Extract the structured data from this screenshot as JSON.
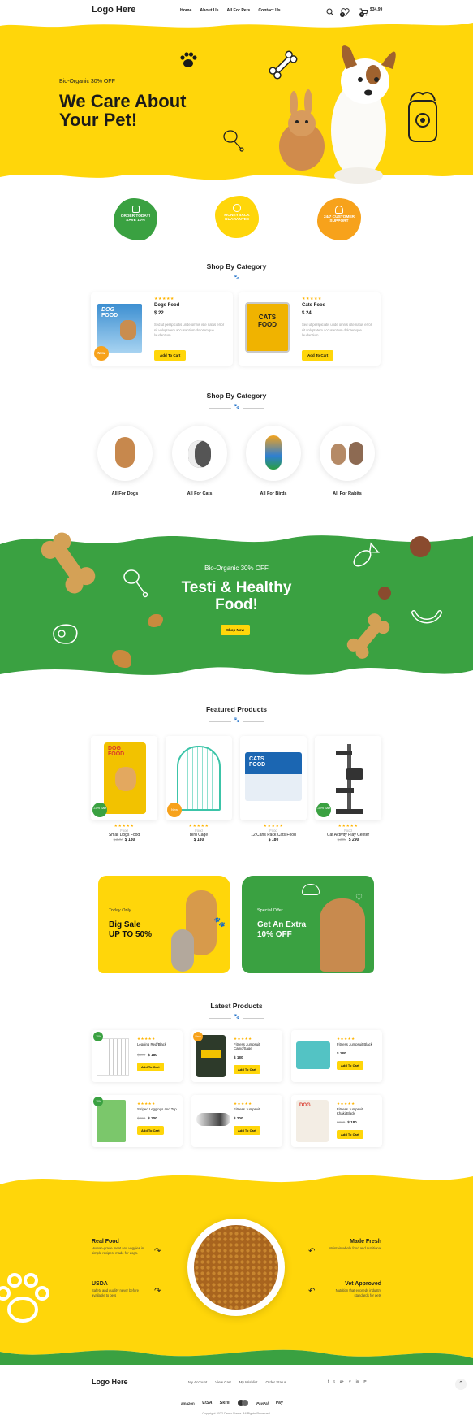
{
  "header": {
    "logo": "Logo Here",
    "nav": [
      "Home",
      "About Us",
      "All For Pets",
      "Contact Us"
    ],
    "wishlist_count": "0",
    "cart_count": "0",
    "cart_total": "$34.99"
  },
  "hero": {
    "kicker": "Bio-Organic 30% OFF",
    "title_line1": "We Care About",
    "title_line2": "Your Pet!"
  },
  "badges": [
    {
      "line1": "ORDER TODAY!",
      "line2": "SAVE 10%"
    },
    {
      "line1": "MONEYBACK",
      "line2": "GUARANTEE"
    },
    {
      "line1": "24/7 CUSTOMER",
      "line2": "SUPPORT"
    }
  ],
  "category_section": {
    "title": "Shop By Category",
    "products": [
      {
        "name": "Dogs Food",
        "price": "$ 22",
        "desc": "Sed ut perspiciatis unde omnis iste natus error sit voluptatem accusantium doloremque laudantium",
        "button": "Add To Cart",
        "badge": "New",
        "rating": "★★★★★",
        "box_label1": "DOG",
        "box_label2": "FOOD"
      },
      {
        "name": "Cats Food",
        "price": "$ 24",
        "desc": "Sed ut perspiciatis unde omnis iste natus error sit voluptatem accusantium doloremque laudantium",
        "button": "Add To Cart",
        "rating": "★★★★★",
        "box_label1": "CATS",
        "box_label2": "FOOD"
      }
    ]
  },
  "category_section2": {
    "title": "Shop By Category",
    "items": [
      "All For Dogs",
      "All For Cats",
      "All For Birds",
      "All For Rabits"
    ]
  },
  "promo": {
    "kicker": "Bio-Organic 30% OFF",
    "title_line1": "Testi & Healthy",
    "title_line2": "Food!",
    "button": "Shop Now"
  },
  "featured": {
    "title": "Featured Products",
    "items": [
      {
        "name": "Small Dogs Food",
        "category": "Food",
        "old": "$300",
        "price": "$ 180",
        "badge": "-10% Sale",
        "rating": "★★★★★"
      },
      {
        "name": "Bird Cage",
        "category": "Food",
        "old": "",
        "price": "$ 180",
        "badge": "New",
        "rating": "★★★★★"
      },
      {
        "name": "12 Cans Pack Cats Food",
        "category": "Food",
        "old": "",
        "price": "$ 180",
        "badge": "",
        "rating": "★★★★★"
      },
      {
        "name": "Cat Activity Play Center",
        "category": "Food",
        "old": "$380",
        "price": "$ 290",
        "badge": "-30% Sale",
        "rating": "★★★★★"
      }
    ]
  },
  "offers": [
    {
      "kicker": "Today Only",
      "line1": "Big Sale",
      "line2": "UP TO 50%"
    },
    {
      "kicker": "Special Offer",
      "line1": "Get An Extra",
      "line2": "10% OFF"
    }
  ],
  "latest": {
    "title": "Latest Products",
    "items": [
      {
        "name": "Legging Red/Black",
        "old": "$300",
        "price": "$ 180",
        "badge": "-10%",
        "button": "Add To Cart",
        "rating": "★★★★★"
      },
      {
        "name": "Fitness Jumpsuit Camo/Sage",
        "old": "",
        "price": "$ 180",
        "badge": "New",
        "button": "Add To Cart",
        "rating": "★★★★★"
      },
      {
        "name": "Fitness Jumpsuit Black",
        "old": "",
        "price": "$ 180",
        "badge": "",
        "button": "Add To Cart",
        "rating": "★★★★★"
      },
      {
        "name": "Striped Leggings and Top",
        "old": "$300",
        "price": "$ 200",
        "badge": "-10%",
        "button": "Add To Cart",
        "rating": "★★★★★"
      },
      {
        "name": "Fitness Jumpsuit",
        "old": "",
        "price": "$ 200",
        "badge": "",
        "button": "Add To Cart",
        "rating": "★★★★★"
      },
      {
        "name": "Fitness Jumpsuit Khaki/Black",
        "old": "$300",
        "price": "$ 180",
        "badge": "",
        "button": "Add To Cart",
        "rating": "★★★★★"
      }
    ]
  },
  "features": [
    {
      "title": "Real Food",
      "desc": "Human-grade meat and veggies in simple recipes, made for dogs."
    },
    {
      "title": "Made Fresh",
      "desc": "Maintain whole food and nutritional"
    },
    {
      "title": "USDA",
      "desc": "Safety and quality never before available to pets"
    },
    {
      "title": "Vet Approved",
      "desc": "Nutrition that exceeds industry standards for pets"
    }
  ],
  "footer": {
    "logo": "Logo Here",
    "links": [
      "My Account",
      "View Cart",
      "My Wishlist",
      "Order Status"
    ],
    "social": [
      "f",
      "t",
      "g+",
      "v",
      "in",
      "P"
    ],
    "payments": [
      "amazon",
      "VISA",
      "Skrill",
      "mc",
      "PayPal",
      "Pay"
    ],
    "copyright": "Copyright 2022 Demo Name. All Rights Reserved."
  },
  "colors": {
    "yellow": "#ffd60a",
    "green": "#3aa141",
    "orange": "#f7a21b"
  }
}
